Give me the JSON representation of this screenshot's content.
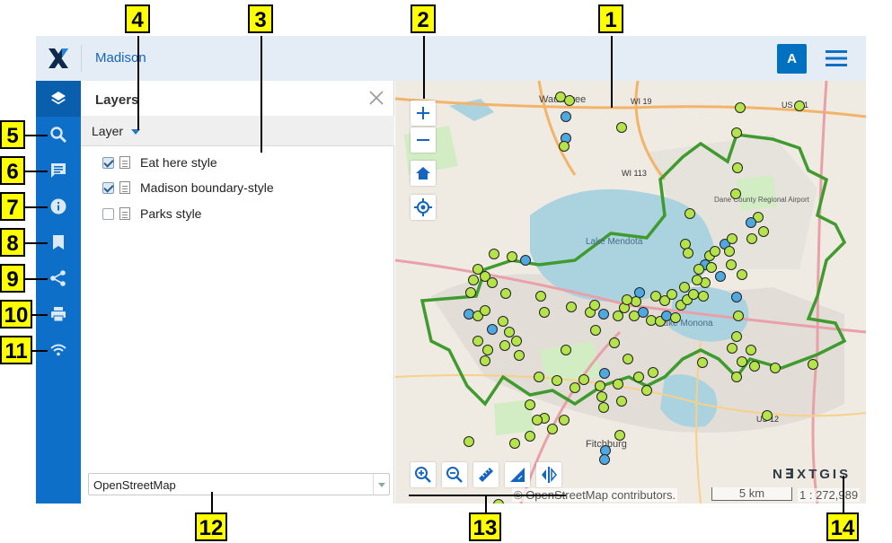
{
  "header": {
    "title": "Madison",
    "avatar": "A"
  },
  "sidebar": {
    "items": [
      {
        "icon": "layers-icon"
      },
      {
        "icon": "search-icon"
      },
      {
        "icon": "chat-icon"
      },
      {
        "icon": "info-icon"
      },
      {
        "icon": "bookmark-icon"
      },
      {
        "icon": "share-icon"
      },
      {
        "icon": "print-icon"
      },
      {
        "icon": "wifi-icon"
      }
    ]
  },
  "panel": {
    "title": "Layers",
    "dropdown_label": "Layer",
    "layers": [
      {
        "name": "Eat here style",
        "checked": true
      },
      {
        "name": "Madison boundary-style",
        "checked": true
      },
      {
        "name": "Parks style",
        "checked": false
      }
    ],
    "basemap": "OpenStreetMap"
  },
  "map": {
    "brand": "N∃XTGIS",
    "attribution": "© OpenStreetMap contributors.",
    "scale": "5 km",
    "ratio": "1 : 272,989",
    "labels": [
      "Lake Mendota",
      "Lake Monona",
      "Dane County Regional Airport",
      "Fitchburg",
      "Waunakee",
      "WI 19",
      "WI 113",
      "US 12",
      "US 151"
    ]
  },
  "callouts": [
    "1",
    "2",
    "3",
    "4",
    "5",
    "6",
    "7",
    "8",
    "9",
    "10",
    "11",
    "12",
    "13",
    "14"
  ],
  "colors": {
    "sidebar": "#0d6fc7",
    "accent": "#1565c0",
    "boundary": "#3f9b2e",
    "poi_green": "#b5e34a",
    "poi_blue": "#4fa8e0"
  }
}
